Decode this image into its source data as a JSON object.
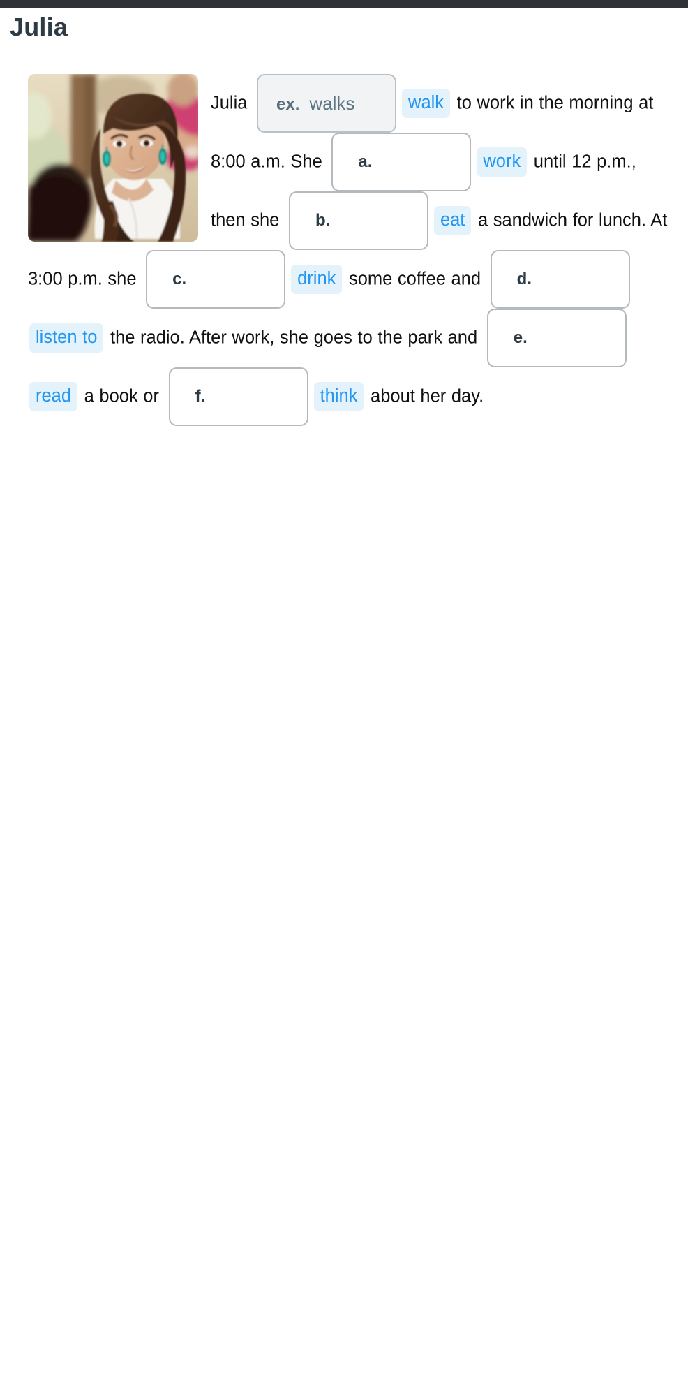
{
  "page": {
    "title": "Julia",
    "topbar_color": "#2f3337",
    "title_color": "#2d3b45"
  },
  "media": {
    "portrait_alt": "Smiling young woman with long dark hair and teal teardrop earrings outdoors"
  },
  "colors": {
    "cue_background": "#e4f2fb",
    "cue_text": "#2196f3",
    "box_border": "#b3b9bd",
    "example_box_background": "#f1f3f4",
    "example_text": "#5b7484",
    "prose_text": "#111111"
  },
  "exercise": {
    "example": {
      "label": "ex.",
      "answer": "walks",
      "cue": "walk"
    },
    "segments": [
      {
        "type": "text",
        "value": "Julia"
      },
      {
        "type": "example_box"
      },
      {
        "type": "cue",
        "value": "walk"
      },
      {
        "type": "text",
        "value": "to work in the morning at 8:00 a.m. She"
      },
      {
        "type": "box",
        "value": "a."
      },
      {
        "type": "cue",
        "value": "work"
      },
      {
        "type": "text",
        "value": "until 12 p.m., then she"
      },
      {
        "type": "box",
        "value": "b."
      },
      {
        "type": "cue",
        "value": "eat"
      },
      {
        "type": "text",
        "value": "a sandwich for lunch. At 3:00 p.m. she"
      },
      {
        "type": "box",
        "value": "c."
      },
      {
        "type": "cue",
        "value": "drink"
      },
      {
        "type": "text",
        "value": "some coffee and"
      },
      {
        "type": "box",
        "value": "d."
      },
      {
        "type": "cue",
        "value": "listen to"
      },
      {
        "type": "text",
        "value": "the radio. After work, she goes to the park and"
      },
      {
        "type": "box",
        "value": "e."
      },
      {
        "type": "cue",
        "value": "read"
      },
      {
        "type": "text",
        "value": "a book or"
      },
      {
        "type": "box",
        "value": "f."
      },
      {
        "type": "cue",
        "value": "think"
      },
      {
        "type": "text",
        "value": "about her day."
      }
    ],
    "blank_labels": [
      "a.",
      "b.",
      "c.",
      "d.",
      "e.",
      "f."
    ],
    "cues": [
      "walk",
      "work",
      "eat",
      "drink",
      "listen to",
      "read",
      "think"
    ],
    "text_runs": {
      "t0": "Julia",
      "t1": "to work in the morning at 8:00 a.m. She",
      "t2": "until 12 p.m., then she",
      "t3": "a sandwich for lunch. At 3:00 p.m. she",
      "t4": "some coffee and",
      "t5": "the radio. After work, she goes to the park and",
      "t6": "a book or",
      "t7": "about her day."
    }
  }
}
